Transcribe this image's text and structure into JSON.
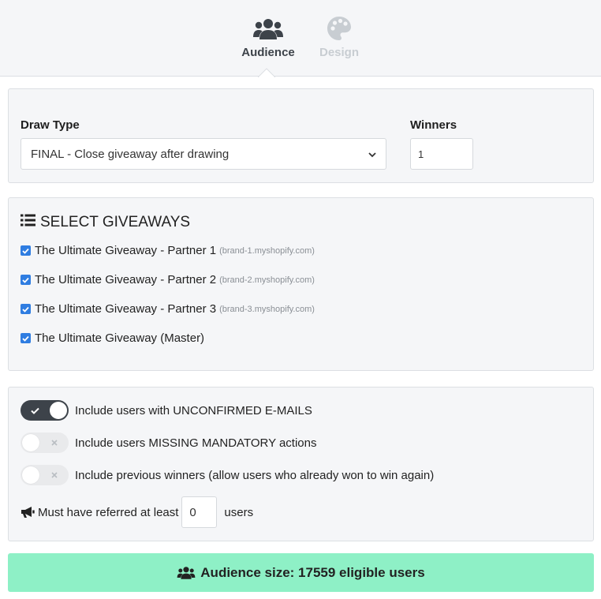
{
  "tabs": {
    "audience": {
      "label": "Audience",
      "icon": "users-icon",
      "active": true
    },
    "design": {
      "label": "Design",
      "icon": "palette-icon",
      "active": false
    }
  },
  "draw": {
    "type_label": "Draw Type",
    "type_value": "FINAL - Close giveaway after drawing",
    "winners_label": "Winners",
    "winners_value": "1"
  },
  "giveaways": {
    "title": "SELECT GIVEAWAYS",
    "items": [
      {
        "name": "The Ultimate Giveaway - Partner 1",
        "domain": "(brand-1.myshopify.com)",
        "checked": true
      },
      {
        "name": "The Ultimate Giveaway - Partner 2",
        "domain": "(brand-2.myshopify.com)",
        "checked": true
      },
      {
        "name": "The Ultimate Giveaway - Partner 3",
        "domain": "(brand-3.myshopify.com)",
        "checked": true
      },
      {
        "name": "The Ultimate Giveaway (Master)",
        "domain": "",
        "checked": true
      }
    ]
  },
  "options": {
    "unconfirmed": {
      "label": "Include users with UNCONFIRMED E-MAILS",
      "on": true
    },
    "missing": {
      "label": "Include users MISSING MANDATORY actions",
      "on": false
    },
    "previous": {
      "label": "Include previous winners (allow users who already won to win again)",
      "on": false
    },
    "referral": {
      "prefix": "Must have referred at least",
      "value": "0",
      "suffix": "users"
    }
  },
  "audience": {
    "text": "Audience size: 17559 eligible users"
  },
  "colors": {
    "accent": "#2f7de1",
    "toggle_on": "#3d434a",
    "audience_bg": "#8ef0c6",
    "panel_bg": "#f5f6f8"
  }
}
